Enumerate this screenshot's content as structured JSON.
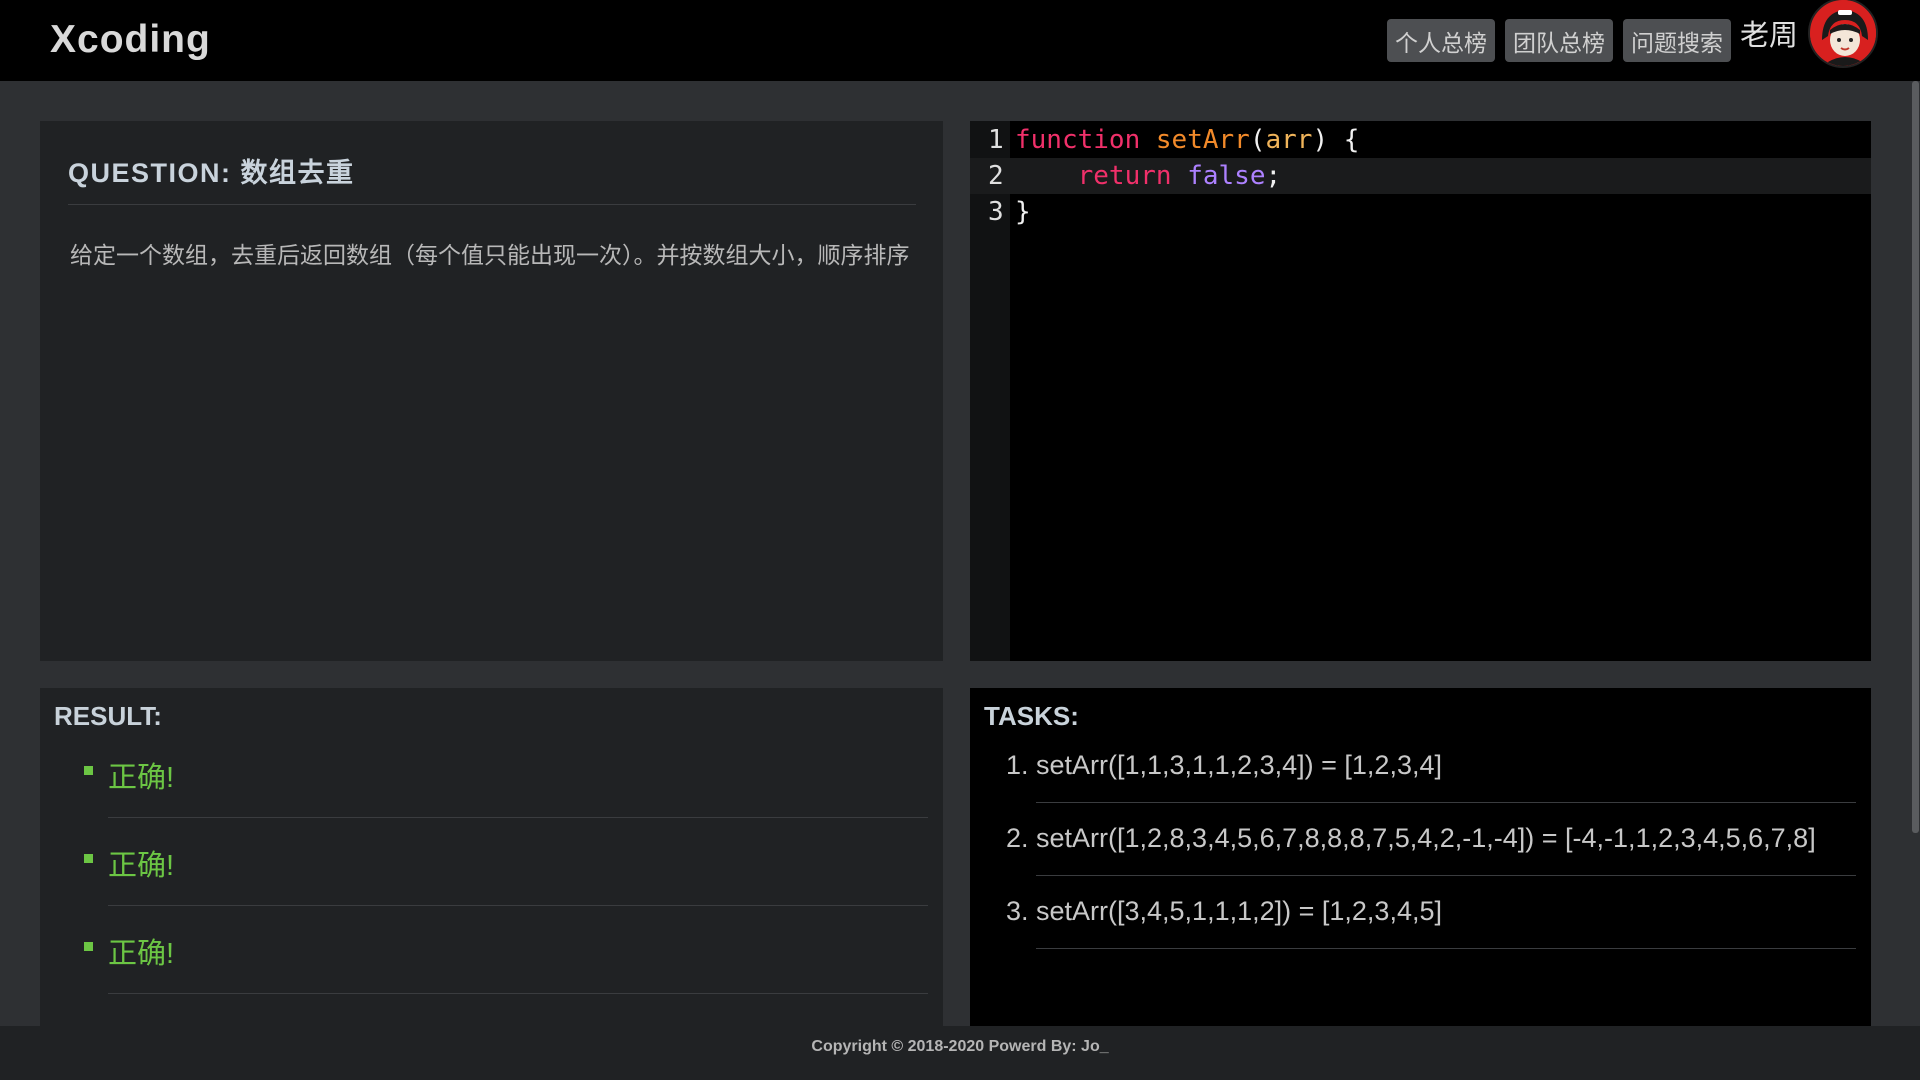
{
  "header": {
    "brand": "Xcoding",
    "nav": [
      "个人总榜",
      "团队总榜",
      "问题搜索"
    ],
    "username": "老周"
  },
  "question": {
    "title": "QUESTION: 数组去重",
    "description": "给定一个数组，去重后返回数组（每个值只能出现一次）。并按数组大小，顺序排序"
  },
  "editor": {
    "line_numbers": [
      "1",
      "2",
      "3"
    ],
    "active_line": 2,
    "lines": [
      [
        {
          "t": "function",
          "c": "kw"
        },
        {
          "t": " ",
          "c": ""
        },
        {
          "t": "setArr",
          "c": "fn"
        },
        {
          "t": "(",
          "c": ""
        },
        {
          "t": "arr",
          "c": "param"
        },
        {
          "t": ") {",
          "c": ""
        }
      ],
      [
        {
          "t": "    ",
          "c": ""
        },
        {
          "t": "return",
          "c": "kw"
        },
        {
          "t": " ",
          "c": ""
        },
        {
          "t": "false",
          "c": "bool"
        },
        {
          "t": ";",
          "c": ""
        }
      ],
      [
        {
          "t": "}",
          "c": ""
        }
      ]
    ]
  },
  "result": {
    "heading": "RESULT:",
    "items": [
      "正确!",
      "正确!",
      "正确!"
    ]
  },
  "tasks": {
    "heading": "TASKS:",
    "items": [
      "setArr([1,1,3,1,1,2,3,4]) = [1,2,3,4]",
      "setArr([1,2,8,3,4,5,6,7,8,8,8,7,5,4,2,-1,-4]) = [-4,-1,1,2,3,4,5,6,7,8]",
      "setArr([3,4,5,1,1,1,2]) = [1,2,3,4,5]"
    ]
  },
  "footer": {
    "copyright": "Copyright © 2018-2020 Powerd By: Jo_"
  },
  "colors": {
    "success": "#6cc644",
    "keyword": "#f0306a",
    "function_name": "#f28a2a",
    "boolean": "#ad81ff",
    "avatar_bg": "#d8201f"
  }
}
